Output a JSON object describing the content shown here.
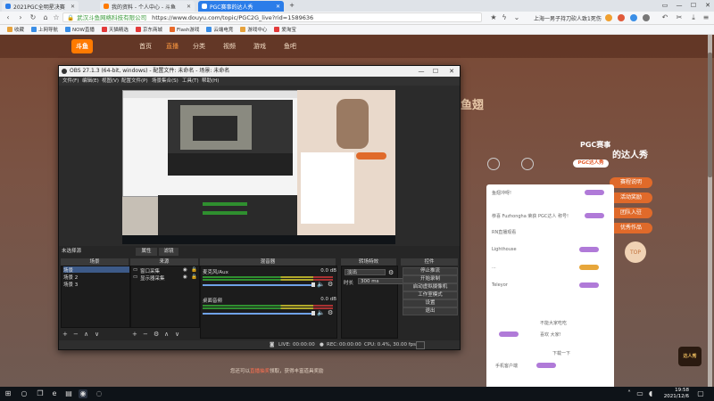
{
  "browser": {
    "tabs": [
      {
        "label": "2021PGC全明星决赛",
        "color": "#2b7de9"
      },
      {
        "label": "我的资料 - 个人中心 - 斗鱼",
        "color": "#ff7a00"
      },
      {
        "label": "PGC赛事的达人秀",
        "color": "#ffffff",
        "active": true
      }
    ],
    "new_tab": "+",
    "window_controls": {
      "restore": "▭",
      "minimize": "—",
      "maximize": "☐",
      "close": "✕"
    },
    "url": {
      "site_name": "武汉斗鱼网络科技有限公司",
      "address": "https://www.douyu.com/topic/PGC2G_live?rid=1589636"
    },
    "news_ticker": "上海一男子持刀砍人致1死伤",
    "bookmarks": [
      {
        "label": "收藏",
        "color": "#e6a23c"
      },
      {
        "label": "上网导航",
        "color": "#3a8ee6"
      },
      {
        "label": "NOW直播",
        "color": "#3a8ee6"
      },
      {
        "label": "天猫精选",
        "color": "#e33a3a"
      },
      {
        "label": "京东商城",
        "color": "#e33a3a"
      },
      {
        "label": "Flash游戏",
        "color": "#e86a2a"
      },
      {
        "label": "云端电竞",
        "color": "#3a8ee6"
      },
      {
        "label": "游戏中心",
        "color": "#e6a23c"
      },
      {
        "label": "爱淘宝",
        "color": "#e33a3a"
      }
    ]
  },
  "douyu": {
    "logo": "斗鱼",
    "nav": [
      "首页",
      "直播",
      "分类",
      "视频",
      "游戏",
      "鱼吧"
    ],
    "banner_title": "鱼翅",
    "banner_sub": "PGC赛事",
    "banner_h2": "的达人秀",
    "pgc_pill": "PGC达人秀",
    "side_buttons": [
      "赛程说明",
      "活动奖励",
      "团队入驻",
      "优秀作品"
    ],
    "top_button": "TOP",
    "footer_hint": "您还可以",
    "footer_highlight": "直播抽奖",
    "footer_tail": "领取，获得丰富道具奖励",
    "chat_lines": [
      "鱼翅冲呀!",
      "恭喜 Fuzhongha 荣获 PGC达人 称号!",
      "RN直播观看",
      "Lighthouse",
      "...",
      "Teleyor",
      "不能大家吃吃",
      "喜欢 大家!",
      "下载一下",
      "手机客户端"
    ],
    "right_badge": "达人秀"
  },
  "obs": {
    "title": "OBS 27.1.3 (64-bit, windows) - 配置文件: 未命名 - 场景: 未命名",
    "menu": [
      "文件(F)",
      "编辑(E)",
      "视图(V)",
      "配置文件(P)",
      "场景集合(S)",
      "工具(T)",
      "帮助(H)"
    ],
    "top_tabs": [
      "未选择源",
      "属性",
      "滤镜"
    ],
    "panels": {
      "scenes": {
        "header": "场景",
        "items": [
          "场景",
          "场景 2",
          "场景 3"
        ]
      },
      "sources": {
        "header": "来源",
        "items": [
          "窗口采集",
          "显示器采集"
        ]
      },
      "mixer": {
        "header": "混音器",
        "channels": [
          {
            "label": "麦克风/Aux",
            "db": "0.0 dB"
          },
          {
            "label": "桌面音频",
            "db": "0.0 dB"
          }
        ]
      },
      "transitions": {
        "header": "转场特效",
        "type": "淡出",
        "duration_label": "时长",
        "duration": "300 ms"
      },
      "controls": {
        "header": "控件",
        "buttons": [
          "停止推流",
          "开始录制",
          "启动虚拟摄像机",
          "工作室模式",
          "设置",
          "退出"
        ]
      }
    },
    "status": {
      "live_label": "LIVE:",
      "live_time": "00:00:00",
      "rec_label": "REC:",
      "rec_time": "00:00:00",
      "cpu": "CPU: 0.4%, 30.00 fps"
    }
  },
  "taskbar": {
    "start_icon": "windows-logo",
    "time": "19:58",
    "date": "2021/12/6"
  }
}
